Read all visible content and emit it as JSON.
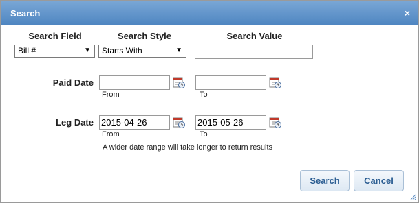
{
  "dialog": {
    "title": "Search",
    "close_symbol": "×"
  },
  "headers": {
    "search_field": "Search Field",
    "search_style": "Search Style",
    "search_value": "Search Value"
  },
  "search_field": {
    "selected": "Bill #"
  },
  "search_style": {
    "selected": "Starts With"
  },
  "search_value": {
    "value": ""
  },
  "paid_date": {
    "label": "Paid Date",
    "from_value": "",
    "to_value": "",
    "from_label": "From",
    "to_label": "To"
  },
  "leg_date": {
    "label": "Leg Date",
    "from_value": "2015-04-26",
    "to_value": "2015-05-26",
    "from_label": "From",
    "to_label": "To"
  },
  "hint": "A wider date range will take longer to return results",
  "buttons": {
    "search": "Search",
    "cancel": "Cancel"
  },
  "icons": {
    "calendar": "calendar-icon",
    "close": "close-icon",
    "dropdown": "chevron-down-icon",
    "resize": "resize-grip-icon"
  },
  "colors": {
    "titlebar": "#5a8fc8",
    "button_text": "#2b5d92"
  }
}
